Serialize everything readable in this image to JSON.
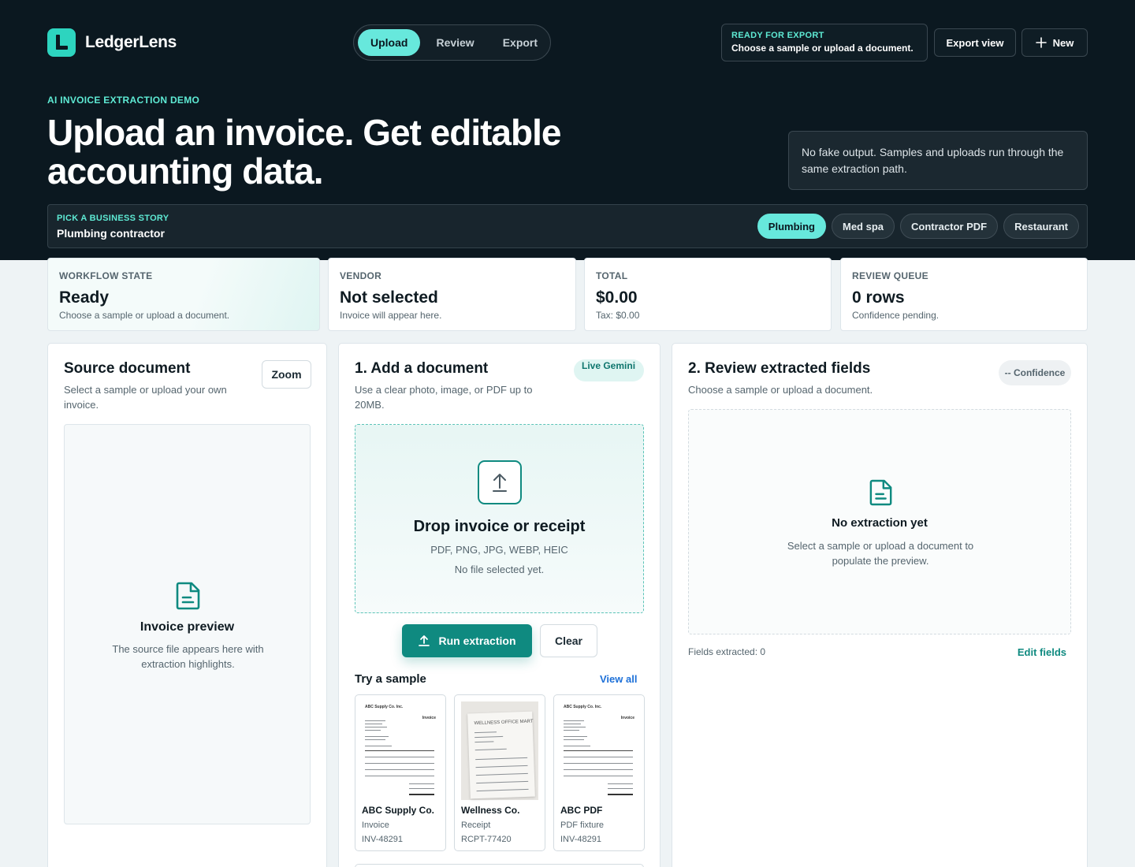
{
  "app": {
    "name": "LedgerLens"
  },
  "nav": {
    "tabs": [
      "Upload",
      "Review",
      "Export"
    ],
    "active": "Upload"
  },
  "status": {
    "title": "READY FOR EXPORT",
    "message": "Choose a sample or upload a document."
  },
  "header_buttons": {
    "export_view": "Export view",
    "new": "New"
  },
  "hero": {
    "eyebrow": "AI INVOICE EXTRACTION DEMO",
    "headline": "Upload an invoice. Get editable accounting data.",
    "note": "No fake output. Samples and uploads run through the same extraction path."
  },
  "story": {
    "eyebrow": "PICK A BUSINESS STORY",
    "value": "Plumbing contractor",
    "options": [
      "Plumbing",
      "Med spa",
      "Contractor PDF",
      "Restaurant"
    ],
    "active": "Plumbing"
  },
  "stats": [
    {
      "label": "WORKFLOW STATE",
      "value": "Ready",
      "sub": "Choose a sample or upload a document."
    },
    {
      "label": "VENDOR",
      "value": "Not selected",
      "sub": "Invoice will appear here."
    },
    {
      "label": "TOTAL",
      "value": "$0.00",
      "sub": "Tax: $0.00"
    },
    {
      "label": "REVIEW QUEUE",
      "value": "0 rows",
      "sub": "Confidence pending."
    }
  ],
  "source": {
    "title": "Source document",
    "subtitle": "Select a sample or upload your own invoice.",
    "zoom": "Zoom",
    "preview_title": "Invoice preview",
    "preview_text": "The source file appears here with extraction highlights."
  },
  "add": {
    "title": "1. Add a document",
    "subtitle": "Use a clear photo, image, or PDF up to 20MB.",
    "badge": "Live Gemini",
    "drop_title": "Drop invoice or receipt",
    "formats": "PDF, PNG, JPG, WEBP, HEIC",
    "file_status": "No file selected yet.",
    "run": "Run extraction",
    "clear": "Clear",
    "samples_title": "Try a sample",
    "view_all": "View all",
    "samples": [
      {
        "name": "ABC Supply Co.",
        "type": "Invoice",
        "id": "INV-48291",
        "thumb_heading": "ABC Supply Co. Inc.",
        "thumb_tag": "Invoice"
      },
      {
        "name": "Wellness Co.",
        "type": "Receipt",
        "id": "RCPT-77420",
        "thumb_heading": "WELLNESS OFFICE MART"
      },
      {
        "name": "ABC PDF",
        "type": "PDF fixture",
        "id": "INV-48291",
        "thumb_heading": "ABC Supply Co. Inc.",
        "thumb_tag": "Invoice"
      }
    ]
  },
  "review": {
    "title": "2. Review extracted fields",
    "subtitle": "Choose a sample or upload a document.",
    "confidence": "-- Confidence",
    "empty_title": "No extraction yet",
    "empty_text": "Select a sample or upload a document to populate the preview.",
    "fields_count": "Fields extracted: 0",
    "edit": "Edit fields"
  },
  "colors": {
    "accent": "#0f8a80",
    "accent_light": "#67e8dc",
    "hero_bg": "#0b1820"
  }
}
